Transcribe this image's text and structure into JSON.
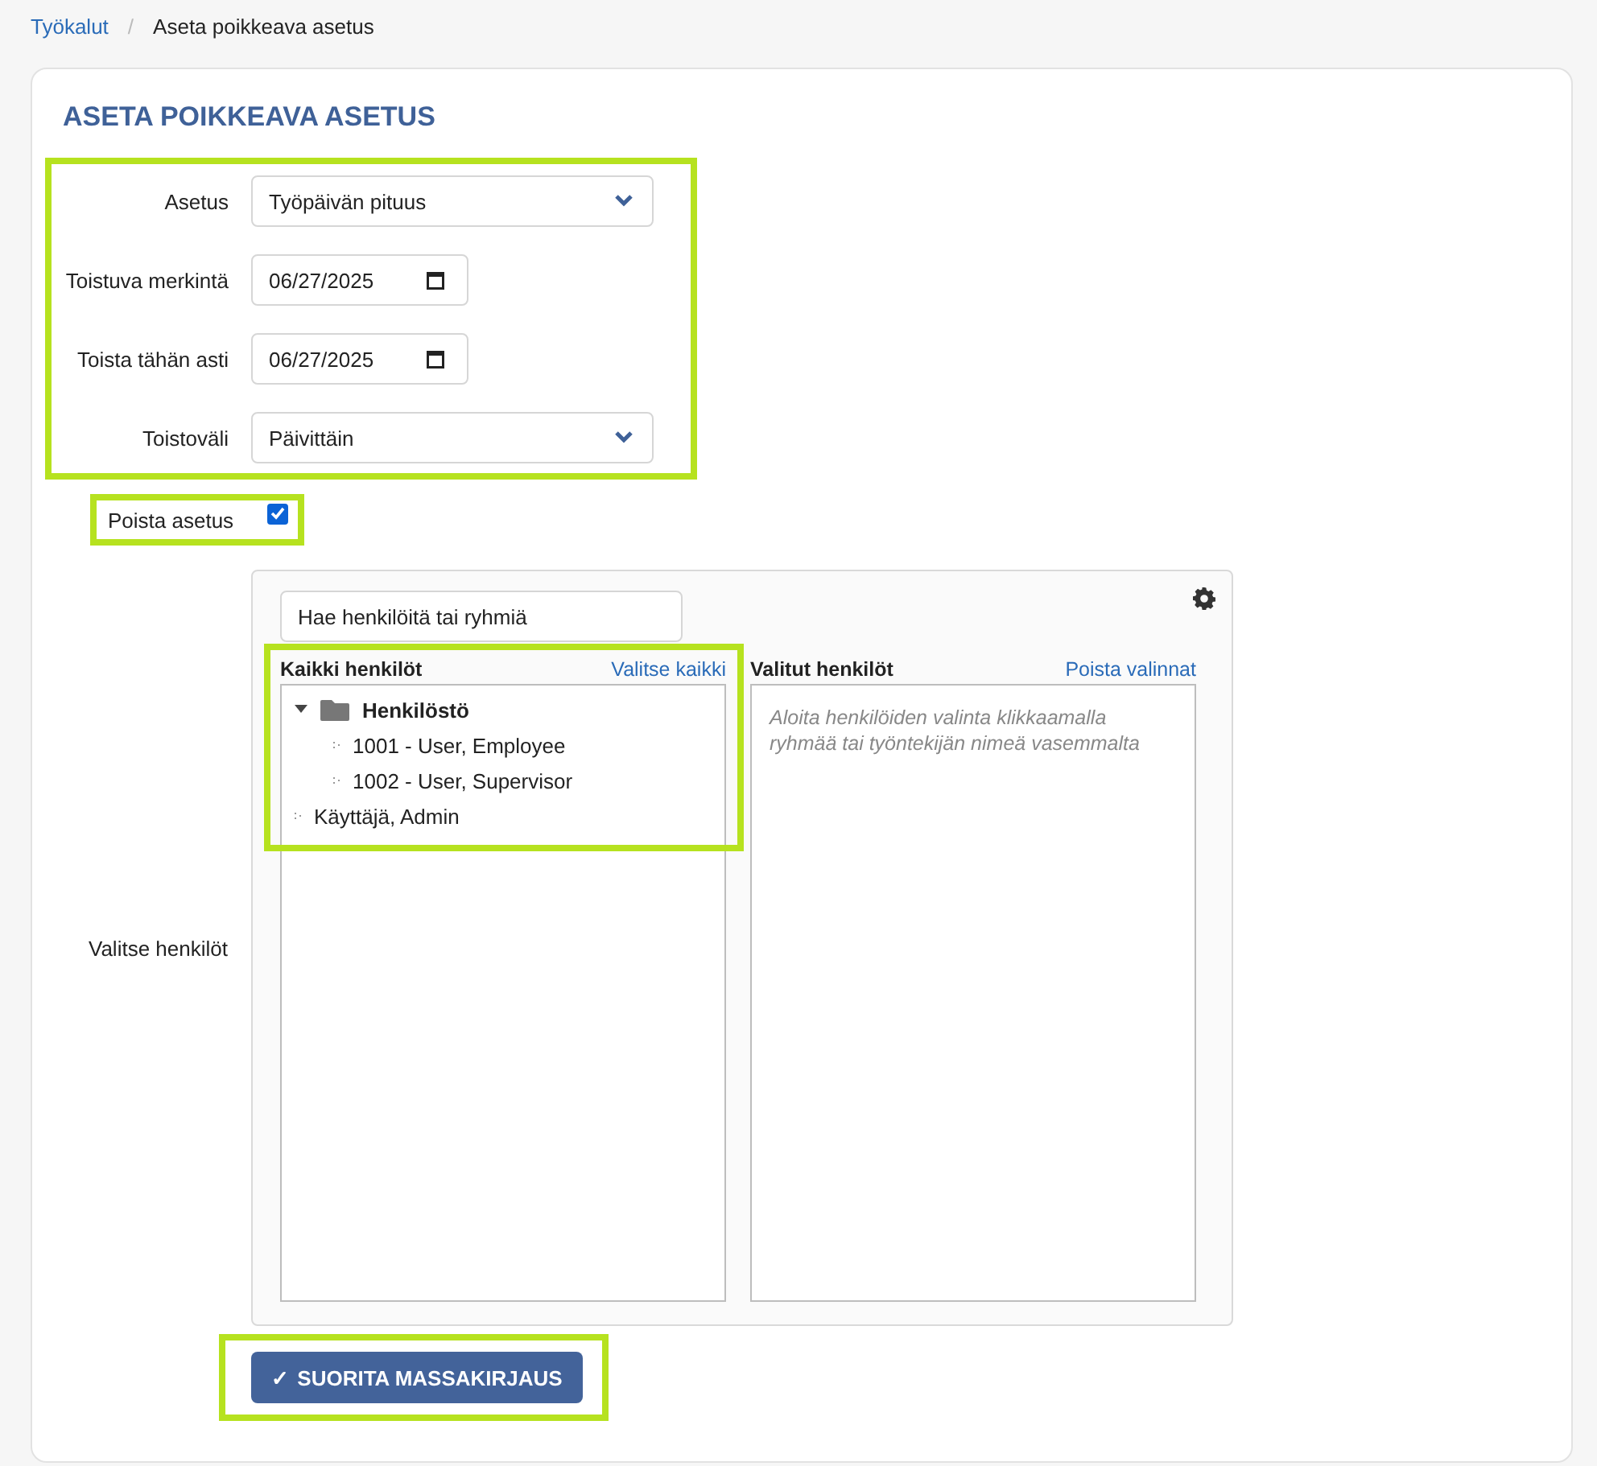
{
  "breadcrumb": [
    {
      "label": "Työkalut",
      "kind": "link"
    },
    {
      "label": "/",
      "kind": "separator"
    },
    {
      "label": "Aseta poikkeava asetus",
      "kind": "current"
    }
  ],
  "title": "ASETA POIKKEAVA ASETUS",
  "fields": [
    {
      "label": "Asetus",
      "kind": "select",
      "value": "Työpäivän pituus"
    },
    {
      "label": "Toistuva merkintä",
      "kind": "date",
      "value": "06/27/2025"
    },
    {
      "label": "Toista tähän asti",
      "kind": "date",
      "value": "06/27/2025"
    },
    {
      "label": "Toistoväli",
      "kind": "select",
      "value": "Päivittäin"
    }
  ],
  "delete_setting": {
    "label": "Poista asetus",
    "checked": true
  },
  "people_picker": {
    "label": "Valitse henkilöt",
    "search": {
      "placeholder": "Hae henkilöitä tai ryhmiä"
    },
    "all_people": {
      "heading": "Kaikki henkilöt",
      "action": "Valitse kaikki",
      "tree": [
        {
          "label": "Henkilöstö",
          "kind": "group",
          "expanded": true,
          "children": [
            {
              "label": "1001 - User, Employee",
              "kind": "person"
            },
            {
              "label": "1002 - User, Supervisor",
              "kind": "person"
            }
          ]
        },
        {
          "label": "Käyttäjä, Admin",
          "kind": "person"
        }
      ]
    },
    "selected_people": {
      "heading": "Valitut henkilöt",
      "action": "Poista valinnat",
      "empty_message": "Aloita henkilöiden valinta klikkaamalla ryhmää tai työntekijän nimeä vasemmalta"
    }
  },
  "submit": {
    "icon": "✓",
    "label": "SUORITA MASSAKIRJAUS"
  }
}
